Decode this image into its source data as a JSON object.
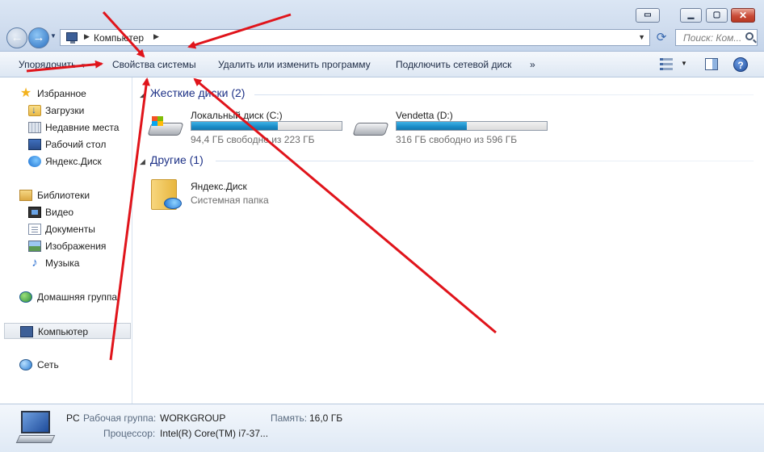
{
  "window": {
    "controls": {
      "minimize": "▁",
      "maximize": "▢",
      "close": "✕",
      "extra": "▭"
    }
  },
  "address": {
    "path": "Компьютер",
    "search_placeholder": "Поиск: Ком..."
  },
  "toolbar": {
    "organize": "Упорядочить",
    "system_properties": "Свойства системы",
    "uninstall": "Удалить или изменить программу",
    "map_network_drive": "Подключить сетевой диск",
    "more": "»",
    "help": "?"
  },
  "sidebar": {
    "favorites": "Избранное",
    "downloads": "Загрузки",
    "recent_places": "Недавние места",
    "desktop": "Рабочий стол",
    "yandex_disk": "Яндекс.Диск",
    "libraries": "Библиотеки",
    "video": "Видео",
    "documents": "Документы",
    "pictures": "Изображения",
    "music": "Музыка",
    "homegroup": "Домашняя группа",
    "computer": "Компьютер",
    "network": "Сеть"
  },
  "content": {
    "hard_drives_header": "Жесткие диски (2)",
    "other_header": "Другие (1)",
    "drives": [
      {
        "name": "Локальный диск (C:)",
        "free": "94,4 ГБ свободно из 223 ГБ",
        "used_fraction": 0.577
      },
      {
        "name": "Vendetta (D:)",
        "free": "316 ГБ свободно из 596 ГБ",
        "used_fraction": 0.47
      }
    ],
    "other": [
      {
        "name": "Яндекс.Диск",
        "description": "Системная папка"
      }
    ]
  },
  "details": {
    "computer_name": "PC",
    "workgroup_label": "Рабочая группа:",
    "workgroup_value": "WORKGROUP",
    "memory_label": "Память:",
    "memory_value": "16,0 ГБ",
    "cpu_label": "Процессор:",
    "cpu_value": "Intel(R) Core(TM) i7-37..."
  },
  "colors": {
    "arrow": "#e0141b",
    "drive_bar": "#1a8cc7",
    "group_header": "#1e3287"
  }
}
